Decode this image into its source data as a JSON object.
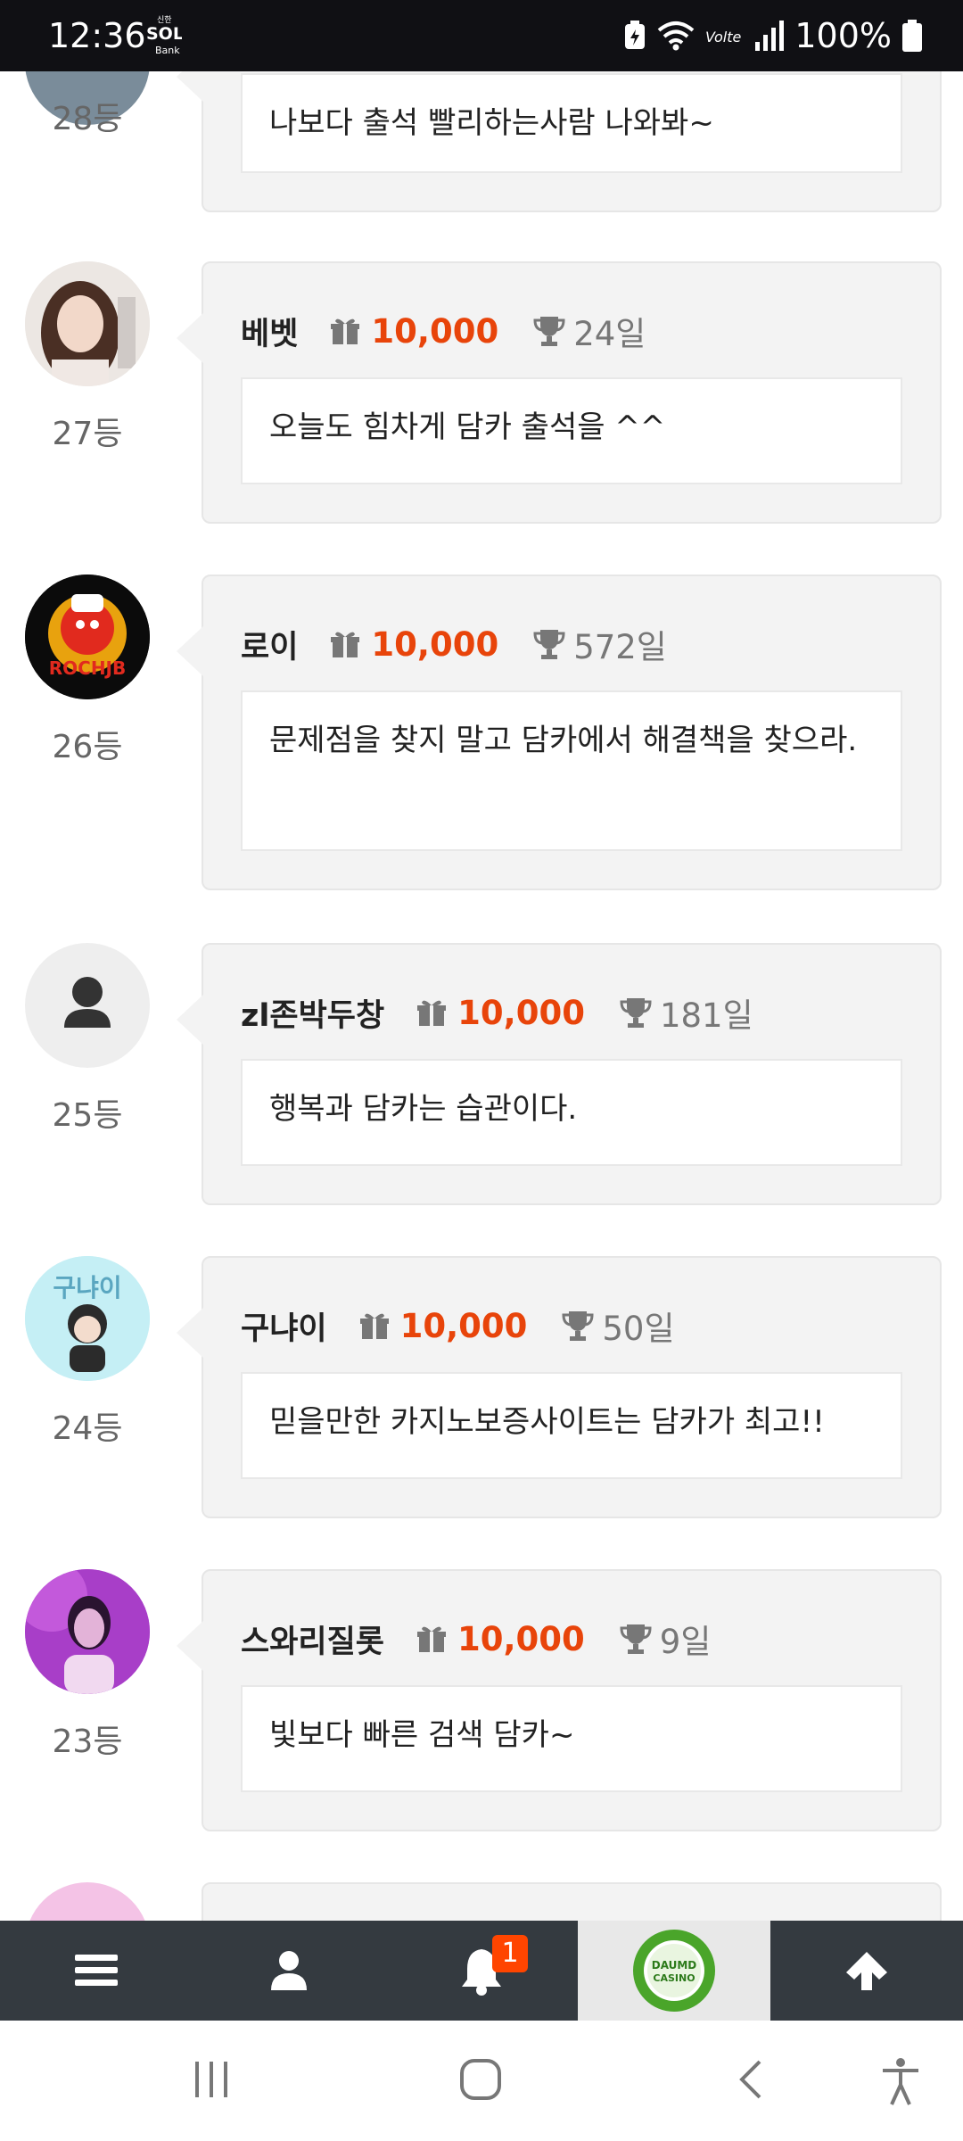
{
  "status_bar": {
    "time": "12:36",
    "bank_small": "신한",
    "bank_sol": "SOL",
    "bank_label": "Bank",
    "volte": "Volte",
    "battery": "100%"
  },
  "entries": [
    {
      "rank": "28등",
      "name": "",
      "points": "",
      "days": "",
      "message": "나보다 출석 빨리하는사람 나와봐~"
    },
    {
      "rank": "27등",
      "name": "베벳",
      "points": "10,000",
      "days": "24일",
      "message": "오늘도 힘차게 담카 출석을 ^^"
    },
    {
      "rank": "26등",
      "name": "로이",
      "points": "10,000",
      "days": "572일",
      "message": "문제점을 찾지 말고 담카에서 해결책을 찾으라.",
      "avatar_text": "ROCHJB"
    },
    {
      "rank": "25등",
      "name": "zl존박두창",
      "points": "10,000",
      "days": "181일",
      "message": "행복과 담카는 습관이다."
    },
    {
      "rank": "24등",
      "name": "구냐이",
      "points": "10,000",
      "days": "50일",
      "message": "믿을만한 카지노보증사이트는 담카가 최고!!",
      "avatar_text": "구냐이"
    },
    {
      "rank": "23등",
      "name": "스와리질롯",
      "points": "10,000",
      "days": "9일",
      "message": "빛보다 빠른 검색 담카~"
    }
  ],
  "appbar": {
    "menu_icon": "menu-icon",
    "user_icon": "user-icon",
    "bell_icon": "bell-icon",
    "notification_count": "1",
    "logo_line1": "DAUMD",
    "logo_line2": "CASINO",
    "up_icon": "arrow-up-icon"
  },
  "colors": {
    "points": "#e8440a",
    "appbar": "#343a40",
    "badge": "#ff4500"
  }
}
